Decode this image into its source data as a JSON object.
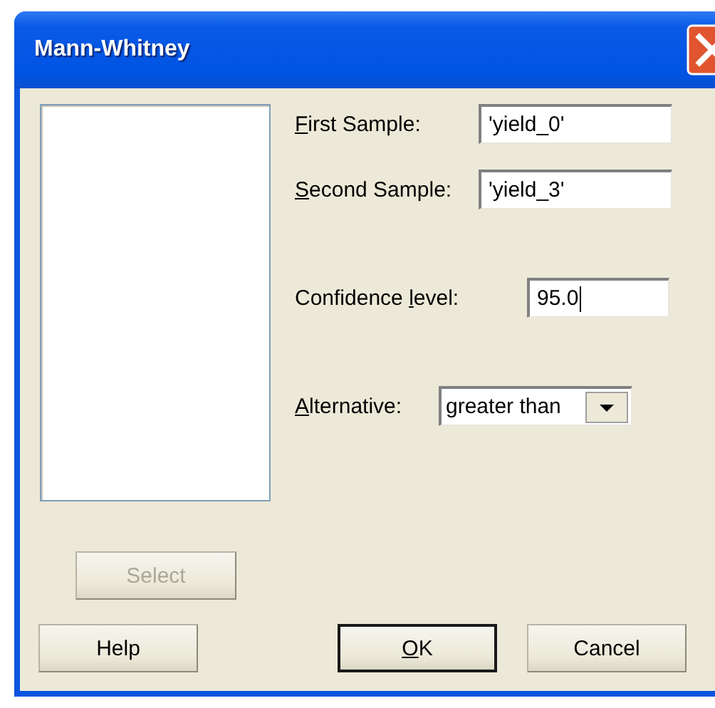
{
  "window": {
    "title": "Mann-Whitney"
  },
  "fields": [
    {
      "kind": "text",
      "label": {
        "key": "F",
        "rest": "irst Sample:"
      },
      "value": "'yield_0'"
    },
    {
      "kind": "text",
      "label": {
        "key": "S",
        "rest": "econd Sample:"
      },
      "value": "'yield_3'"
    },
    {
      "kind": "text",
      "label": {
        "lead": "Confidence ",
        "key": "l",
        "rest": "evel:"
      },
      "value": "95.0",
      "focused": true
    },
    {
      "kind": "combo",
      "label": {
        "key": "A",
        "rest": "lternative:"
      },
      "value": "greater than"
    }
  ],
  "select_button": {
    "label": {
      "rest": "Select"
    },
    "disabled": true
  },
  "buttons": [
    {
      "label": {
        "rest": "Help"
      },
      "disabled": false,
      "default": false
    },
    {
      "label": {
        "key": "O",
        "rest": "K"
      },
      "disabled": false,
      "default": true
    },
    {
      "label": {
        "rest": "Cancel"
      },
      "disabled": false,
      "default": false
    }
  ]
}
